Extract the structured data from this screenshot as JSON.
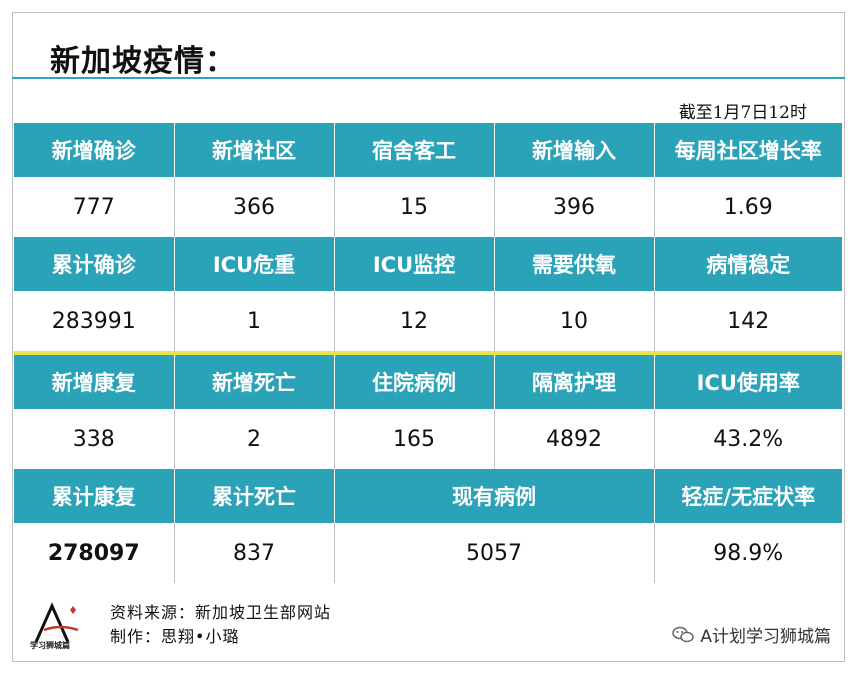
{
  "title": "新加坡疫情：",
  "date": "截至1月7日12时",
  "rows": [
    {
      "headers": [
        "新增确诊",
        "新增社区",
        "宿舍客工",
        "新增输入",
        "每周社区增长率"
      ],
      "values": [
        "777",
        "366",
        "15",
        "396",
        "1.69"
      ]
    },
    {
      "headers": [
        "累计确诊",
        "ICU危重",
        "ICU监控",
        "需要供氧",
        "病情稳定"
      ],
      "values": [
        "283991",
        "1",
        "12",
        "10",
        "142"
      ]
    },
    {
      "headers": [
        "新增康复",
        "新增死亡",
        "住院病例",
        "隔离护理",
        "ICU使用率"
      ],
      "values": [
        "338",
        "2",
        "165",
        "4892",
        "43.2%"
      ]
    },
    {
      "headers": [
        "累计康复",
        "累计死亡",
        "现有病例",
        "轻症/无症状率"
      ],
      "values": [
        "278097",
        "837",
        "5057",
        "98.9%"
      ]
    }
  ],
  "footer": {
    "source": "资料来源：新加坡卫生部网站",
    "author": "制作：思翔•小璐",
    "logo_caption": "学习狮城篇",
    "watermark": "A计划学习狮城篇"
  },
  "colors": {
    "header_bg": "#2aa2b8",
    "separator": "#e8e34a",
    "logo_red": "#c0392b"
  }
}
